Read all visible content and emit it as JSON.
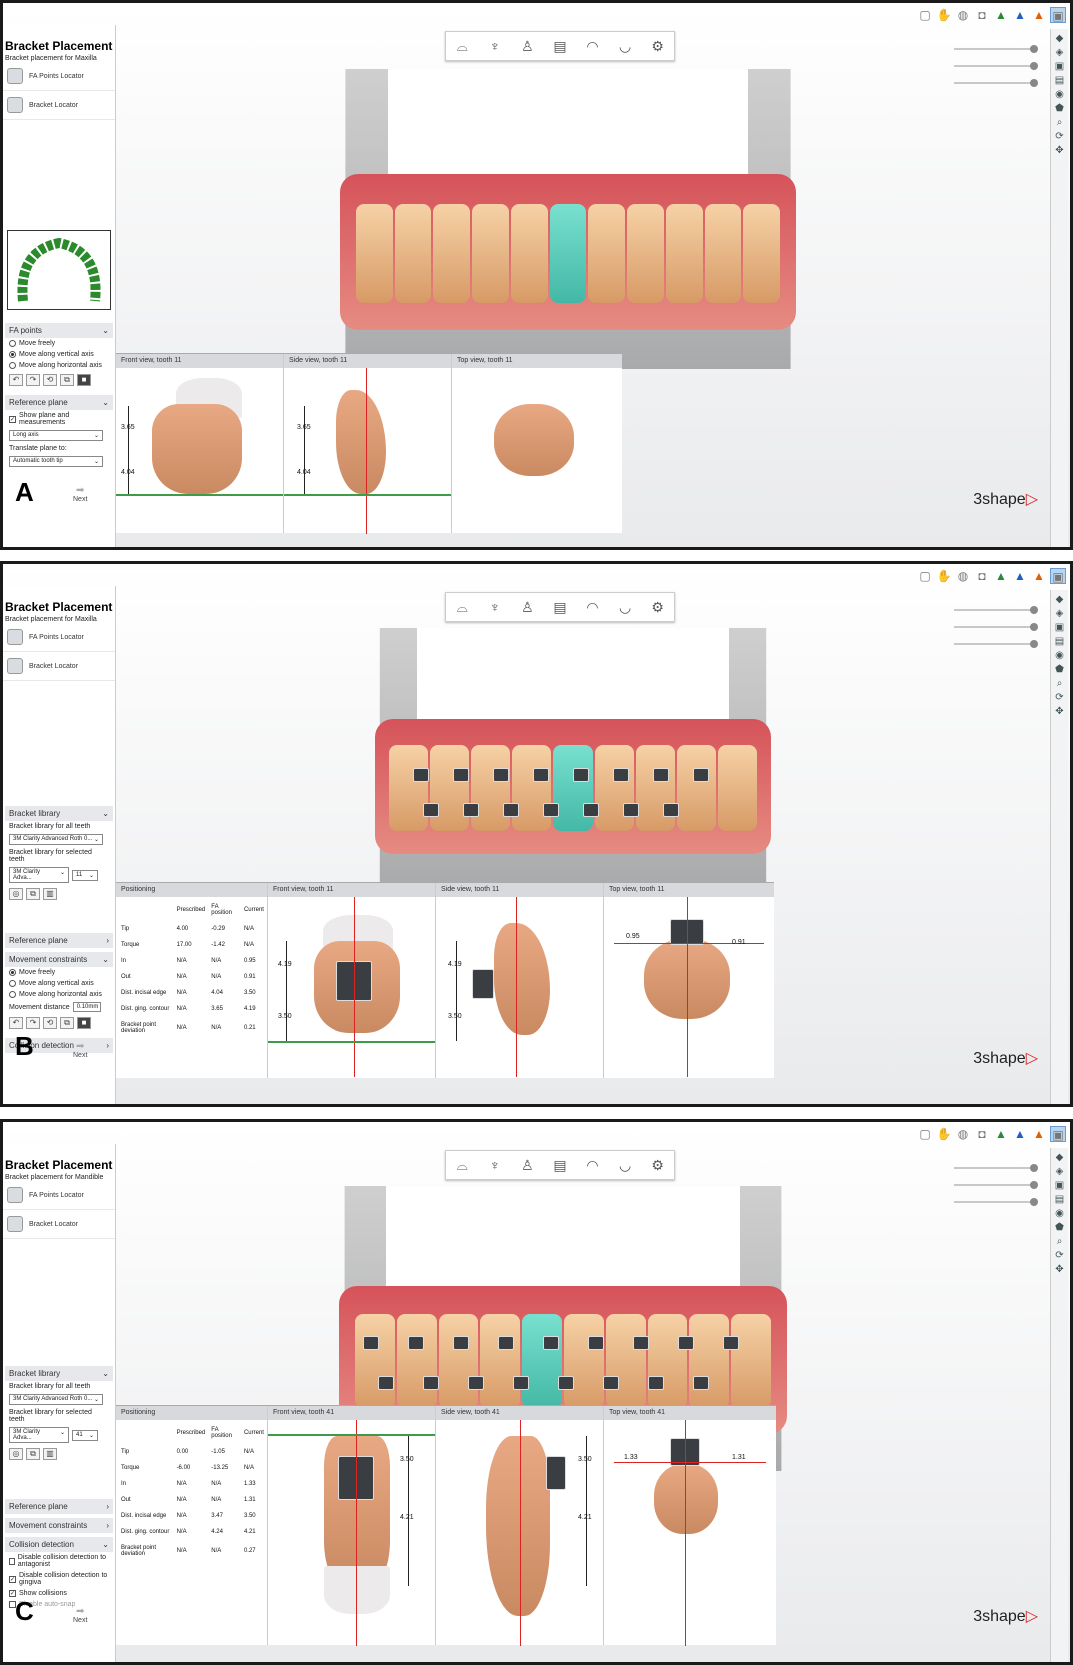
{
  "panels": [
    {
      "id": "A",
      "letter": "A",
      "title": "Bracket Placement",
      "subtitle": "Bracket placement for Maxilla",
      "nav": [
        {
          "label": "FA Points Locator",
          "icon": "fa-points-icon"
        },
        {
          "label": "Bracket Locator",
          "icon": "bracket-locator-icon"
        }
      ],
      "fa_section": "FA points",
      "fa_options": [
        "Move freely",
        "Move along vertical axis",
        "Move along horizontal axis"
      ],
      "ref_section": "Reference plane",
      "ref_check": "Show plane and measurements",
      "ref_select": "Long axis",
      "translate_label": "Translate plane to:",
      "translate_select": "Automatic tooth tip",
      "next": "Next",
      "views": [
        "Front view, tooth 11",
        "Side view, tooth 11",
        "Top view, tooth 11"
      ],
      "dims": {
        "upper": "3.65",
        "lower": "4.04"
      }
    },
    {
      "id": "B",
      "letter": "B",
      "title": "Bracket Placement",
      "subtitle": "Bracket placement for Maxilla",
      "nav": [
        {
          "label": "FA Points Locator",
          "icon": "fa-points-icon"
        },
        {
          "label": "Bracket Locator",
          "icon": "bracket-locator-icon"
        }
      ],
      "lib_section": "Bracket library",
      "lib_all_label": "Bracket library for all teeth",
      "lib_all_value": "3M Clarity Advanced Roth 0...",
      "lib_sel_label": "Bracket library for selected teeth",
      "lib_sel_value": "3M Clarity Adva...",
      "lib_tooth": "11",
      "ref_section": "Reference plane",
      "move_section": "Movement constraints",
      "move_options": [
        "Move freely",
        "Move along vertical axis",
        "Move along horizontal axis"
      ],
      "move_dist_label": "Movement distance",
      "move_dist_value": "0.10mm",
      "coll_section": "Collision detection",
      "next": "Next",
      "positioning": {
        "header": "Positioning",
        "cols": [
          "Prescribed",
          "FA position",
          "Current"
        ],
        "rows": [
          [
            "Tip",
            "4.00",
            "-0.29",
            "N/A"
          ],
          [
            "Torque",
            "17.00",
            "-1.42",
            "N/A"
          ],
          [
            "In",
            "N/A",
            "N/A",
            "0.95"
          ],
          [
            "Out",
            "N/A",
            "N/A",
            "0.91"
          ],
          [
            "Dist. incisal edge",
            "N/A",
            "4.04",
            "3.50"
          ],
          [
            "Dist. ging. contour",
            "N/A",
            "3.65",
            "4.19"
          ],
          [
            "Bracket point deviation",
            "N/A",
            "N/A",
            "0.21"
          ]
        ]
      },
      "views": [
        "Front view, tooth 11",
        "Side view, tooth 11",
        "Top view, tooth 11"
      ],
      "dims": {
        "upper": "4.19",
        "lower": "3.50",
        "left": "0.95",
        "right": "0.91"
      }
    },
    {
      "id": "C",
      "letter": "C",
      "title": "Bracket Placement",
      "subtitle": "Bracket placement for Mandible",
      "nav": [
        {
          "label": "FA Points Locator",
          "icon": "fa-points-icon"
        },
        {
          "label": "Bracket Locator",
          "icon": "bracket-locator-icon"
        }
      ],
      "lib_section": "Bracket library",
      "lib_all_label": "Bracket library for all teeth",
      "lib_all_value": "3M Clarity Advanced Roth 0...",
      "lib_sel_label": "Bracket library for selected teeth",
      "lib_sel_value": "3M Clarity Adva...",
      "lib_tooth": "41",
      "ref_section": "Reference plane",
      "move_section": "Movement constraints",
      "coll_section": "Collision detection",
      "coll_options": [
        "Disable collision detection to antagonist",
        "Disable collision detection to gingiva",
        "Show collisions",
        "Disable auto-snap"
      ],
      "next": "Next",
      "positioning": {
        "header": "Positioning",
        "cols": [
          "Prescribed",
          "FA position",
          "Current"
        ],
        "rows": [
          [
            "Tip",
            "0.00",
            "-1.05",
            "N/A"
          ],
          [
            "Torque",
            "-6.00",
            "-13.25",
            "N/A"
          ],
          [
            "In",
            "N/A",
            "N/A",
            "1.33"
          ],
          [
            "Out",
            "N/A",
            "N/A",
            "1.31"
          ],
          [
            "Dist. incisal edge",
            "N/A",
            "3.47",
            "3.50"
          ],
          [
            "Dist. ging. contour",
            "N/A",
            "4.24",
            "4.21"
          ],
          [
            "Bracket point deviation",
            "N/A",
            "N/A",
            "0.27"
          ]
        ]
      },
      "views": [
        "Front view, tooth 41",
        "Side view, tooth 41",
        "Top view, tooth 41"
      ],
      "dims": {
        "upper": "3.50",
        "lower": "4.21",
        "left": "1.33",
        "right": "1.31"
      }
    }
  ],
  "brand": {
    "name": "3shape",
    "mark": "▷"
  },
  "colors": {
    "gum": "#d5535a",
    "tooth": "#e3ac7b",
    "selected_tooth": "#5ccab9",
    "bracket": "#3a3d42",
    "accent_green": "#3f9a4a",
    "axis_red": "#dd2222"
  }
}
